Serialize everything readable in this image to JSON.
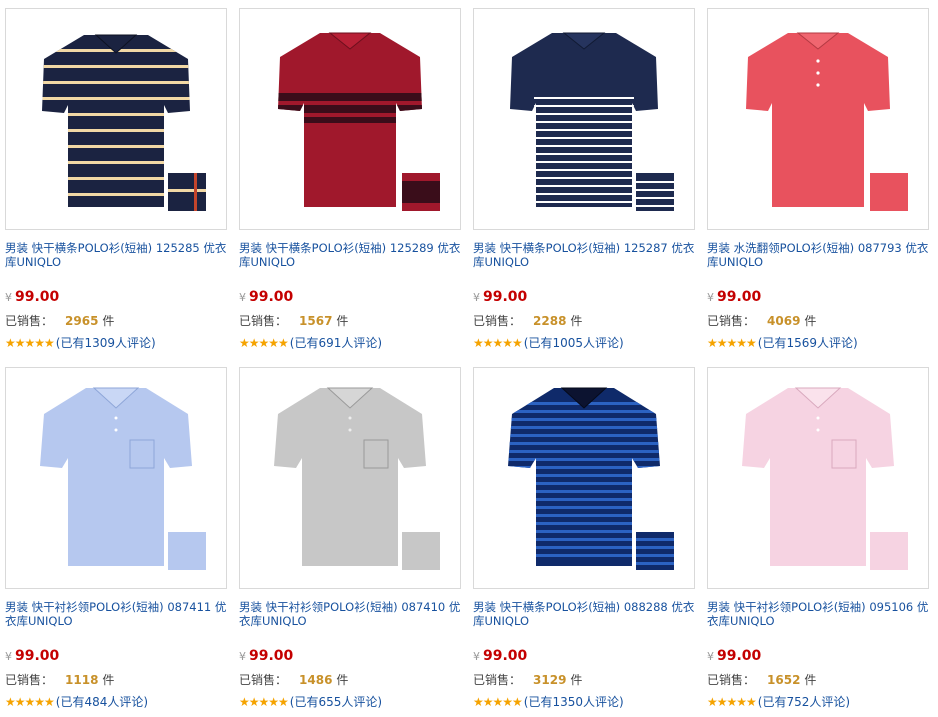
{
  "currency_symbol": "¥",
  "sold_label": "已销售：",
  "sold_unit": "件",
  "stars": "★★★★★",
  "colors": {
    "title_link": "#17519e",
    "price": "#c40000",
    "sold_count": "#c8912a",
    "star": "#f5a300"
  },
  "products": [
    {
      "title": "男装 快干横条POLO衫(短袖) 125285 优衣库UNIQLO",
      "price": "99.00",
      "sold": "2965",
      "reviews": "(已有1309人评论)",
      "image": "navy-cream-stripe-polo",
      "body_color": "#1b2341",
      "stripe_color": "#f1d8a5"
    },
    {
      "title": "男装 快干横条POLO衫(短袖) 125289 优衣库UNIQLO",
      "price": "99.00",
      "sold": "1567",
      "reviews": "(已有691人评论)",
      "image": "red-chest-stripe-polo",
      "body_color": "#a0182c",
      "stripe_color": "#3a0d1a"
    },
    {
      "title": "男装 快干横条POLO衫(短袖) 125287 优衣库UNIQLO",
      "price": "99.00",
      "sold": "2288",
      "reviews": "(已有1005人评论)",
      "image": "navy-white-stripe-polo",
      "body_color": "#1e2a4f",
      "stripe_color": "#ffffff"
    },
    {
      "title": "男装 水洗翻领POLO衫(短袖) 087793 优衣库UNIQLO",
      "price": "99.00",
      "sold": "4069",
      "reviews": "(已有1569人评论)",
      "image": "coral-polo",
      "body_color": "#e8525e",
      "stripe_color": ""
    },
    {
      "title": "男装 快干衬衫领POLO衫(短袖) 087411 优衣库UNIQLO",
      "price": "99.00",
      "sold": "1118",
      "reviews": "(已有484人评论)",
      "image": "light-blue-polo",
      "body_color": "#b6c8ef",
      "stripe_color": ""
    },
    {
      "title": "男装 快干衬衫领POLO衫(短袖) 087410 优衣库UNIQLO",
      "price": "99.00",
      "sold": "1486",
      "reviews": "(已有655人评论)",
      "image": "grey-polo",
      "body_color": "#c7c7c7",
      "stripe_color": ""
    },
    {
      "title": "男装 快干横条POLO衫(短袖) 088288 优衣库UNIQLO",
      "price": "99.00",
      "sold": "3129",
      "reviews": "(已有1350人评论)",
      "image": "blue-navy-stripe-polo",
      "body_color": "#0f2a6a",
      "stripe_color": "#2b62c2"
    },
    {
      "title": "男装 快干衬衫领POLO衫(短袖) 095106 优衣库UNIQLO",
      "price": "99.00",
      "sold": "1652",
      "reviews": "(已有752人评论)",
      "image": "pink-polo",
      "body_color": "#f6d3e2",
      "stripe_color": ""
    }
  ]
}
